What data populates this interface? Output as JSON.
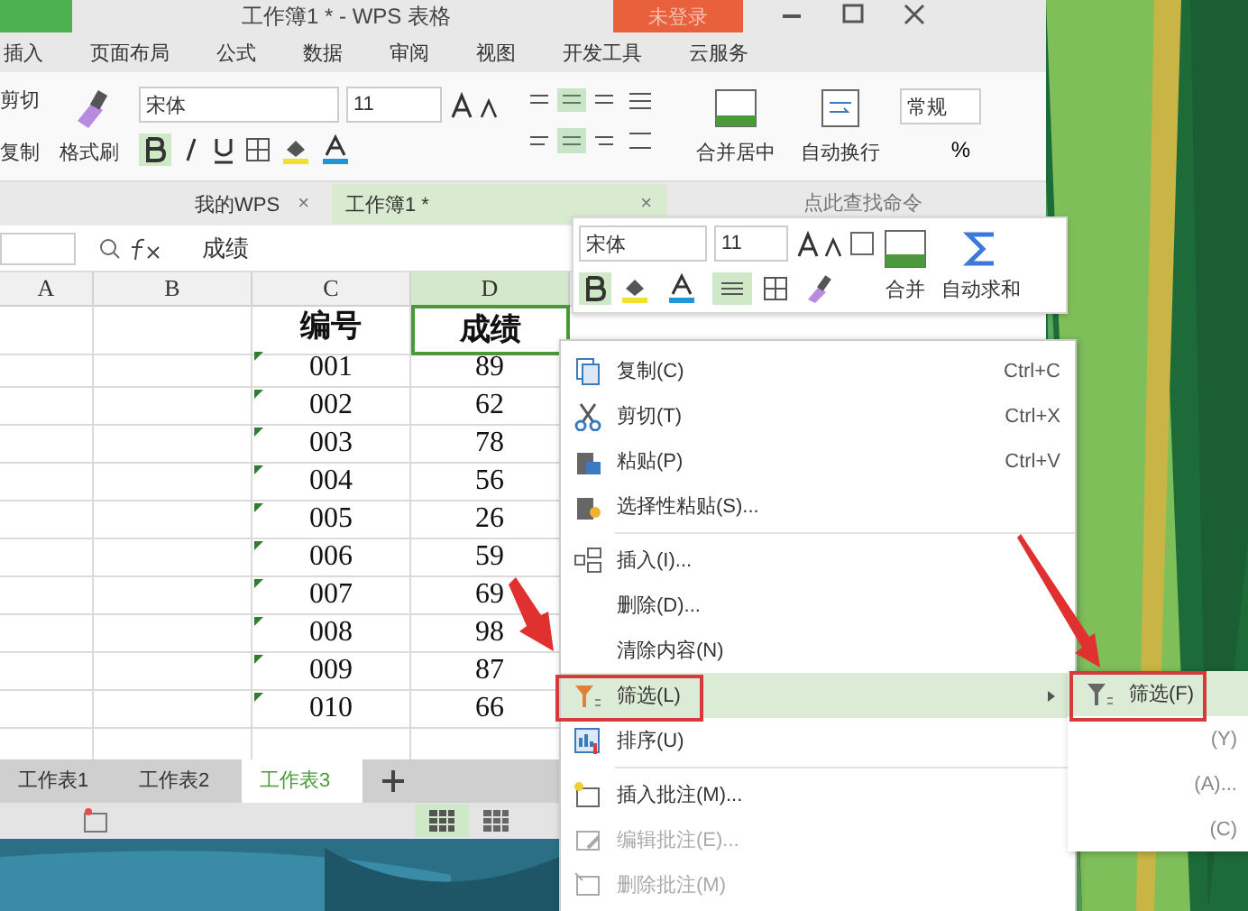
{
  "title_bar": {
    "title": "工作簿1 * - WPS 表格",
    "login_button": "未登录"
  },
  "menu_tabs": [
    "插入",
    "页面布局",
    "公式",
    "数据",
    "审阅",
    "视图",
    "开发工具",
    "云服务"
  ],
  "ribbon": {
    "clipboard": [
      "剪切",
      "复制"
    ],
    "format_painter": "格式刷",
    "font": "宋体",
    "font_size": "11",
    "merge": "合并居中",
    "wrap": "自动换行",
    "number_format": "常规",
    "percent": "%"
  },
  "doc_tabs": [
    {
      "label": "我的WPS",
      "close": "×",
      "selected": false
    },
    {
      "label": "工作簿1 *",
      "close": "×",
      "selected": true
    }
  ],
  "search": {
    "placeholder": "点此查找命令"
  },
  "formula_bar": {
    "value": "成绩"
  },
  "columns": [
    {
      "label": "A",
      "selected": false
    },
    {
      "label": "B",
      "selected": false
    },
    {
      "label": "C",
      "selected": false
    },
    {
      "label": "D",
      "selected": true
    }
  ],
  "rows": [
    {
      "kind": "header",
      "c": "编号",
      "d": "成绩"
    },
    {
      "kind": "data",
      "c": "001",
      "d": "89"
    },
    {
      "kind": "data",
      "c": "002",
      "d": "62"
    },
    {
      "kind": "data",
      "c": "003",
      "d": "78"
    },
    {
      "kind": "data",
      "c": "004",
      "d": "56"
    },
    {
      "kind": "data",
      "c": "005",
      "d": "26"
    },
    {
      "kind": "data",
      "c": "006",
      "d": "59"
    },
    {
      "kind": "data",
      "c": "007",
      "d": "69"
    },
    {
      "kind": "data",
      "c": "008",
      "d": "98"
    },
    {
      "kind": "data",
      "c": "009",
      "d": "87"
    },
    {
      "kind": "data",
      "c": "010",
      "d": "66"
    }
  ],
  "sheet_tabs": [
    {
      "label": "工作表1",
      "selected": false
    },
    {
      "label": "工作表2",
      "selected": false
    },
    {
      "label": "工作表3",
      "selected": true
    }
  ],
  "mini_toolbar": {
    "font": "宋体",
    "font_size": "11",
    "merge": "合并",
    "autosum": "自动求和"
  },
  "context_menu": [
    {
      "label": "复制(C)",
      "shortcut": "Ctrl+C",
      "selected": false,
      "disabled": false,
      "separator_before": false
    },
    {
      "label": "剪切(T)",
      "shortcut": "Ctrl+X",
      "selected": false,
      "disabled": false,
      "separator_before": false
    },
    {
      "label": "粘贴(P)",
      "shortcut": "Ctrl+V",
      "selected": false,
      "disabled": false,
      "separator_before": false
    },
    {
      "label": "选择性粘贴(S)...",
      "selected": false,
      "disabled": false,
      "separator_before": false
    },
    {
      "label": "插入(I)...",
      "selected": false,
      "disabled": false,
      "separator_before": true
    },
    {
      "label": "删除(D)...",
      "selected": false,
      "disabled": false,
      "separator_before": false
    },
    {
      "label": "清除内容(N)",
      "selected": false,
      "disabled": false,
      "separator_before": false
    },
    {
      "label": "筛选(L)",
      "selected": true,
      "disabled": false,
      "separator_before": false,
      "submenu": true
    },
    {
      "label": "排序(U)",
      "selected": false,
      "disabled": false,
      "separator_before": false
    },
    {
      "label": "插入批注(M)...",
      "selected": false,
      "disabled": false,
      "separator_before": true
    },
    {
      "label": "编辑批注(E)...",
      "selected": false,
      "disabled": true,
      "separator_before": false
    },
    {
      "label": "删除批注(M)",
      "selected": false,
      "disabled": true,
      "separator_before": false
    }
  ],
  "submenu": [
    {
      "label": "筛选(F)",
      "selected": true
    },
    {
      "label": "(Y)",
      "selected": false
    },
    {
      "label": "(A)...",
      "selected": false
    },
    {
      "label": "(C)",
      "selected": false
    }
  ]
}
